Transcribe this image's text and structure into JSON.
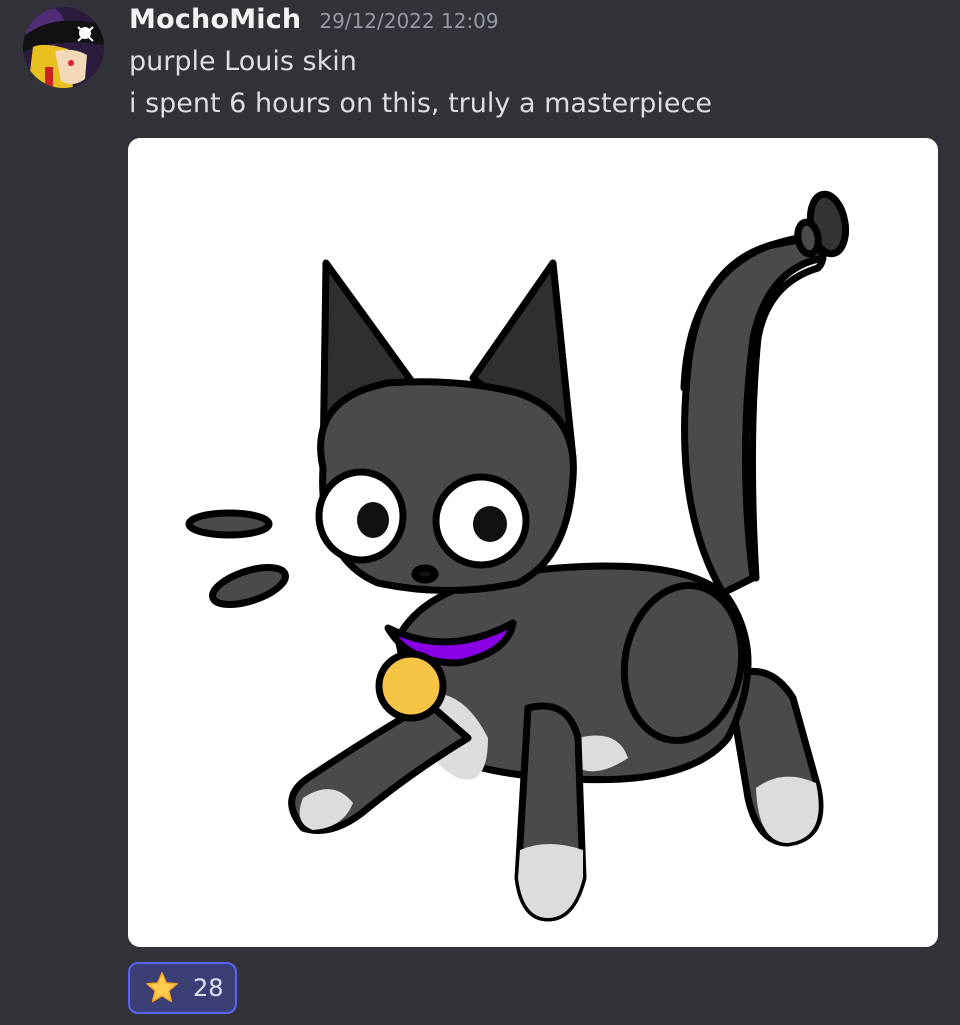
{
  "message": {
    "author": "MochoMich",
    "timestamp": "29/12/2022 12:09",
    "lines": [
      "purple Louis skin",
      "i spent 6 hours on this, truly a masterpiece"
    ],
    "avatar_icon": "pirate-avatar-icon",
    "attachment": {
      "type": "image",
      "description_icon": "cartoon-cat-image"
    },
    "reactions": [
      {
        "emoji": "star-icon",
        "count": "28",
        "active": true
      }
    ]
  },
  "colors": {
    "background": "#313338",
    "username": "#f2f3f5",
    "timestamp": "#949ba4",
    "text": "#dbdee1",
    "reaction_border": "#5865f2",
    "reaction_bg": "#3b3f73",
    "collar": "#8a00e6",
    "bell": "#f6c444",
    "cat_body": "#4a4a4c",
    "cat_ear": "#2f2f31"
  }
}
